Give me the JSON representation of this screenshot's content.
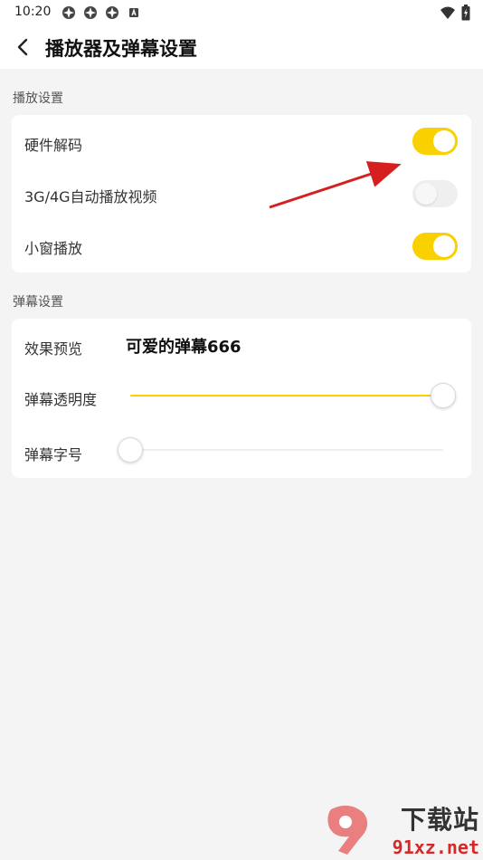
{
  "status_bar": {
    "time": "10:20",
    "left_icons": [
      "app-icon",
      "app-icon",
      "app-icon",
      "a-badge-icon"
    ],
    "right_icons": [
      "wifi-icon",
      "battery-icon"
    ]
  },
  "header": {
    "back_icon": "chevron-left-icon",
    "title": "播放器及弹幕设置"
  },
  "playback_section": {
    "label": "播放设置",
    "rows": [
      {
        "label": "硬件解码",
        "toggle": true
      },
      {
        "label": "3G/4G自动播放视频",
        "toggle": false
      },
      {
        "label": "小窗播放",
        "toggle": true
      }
    ]
  },
  "danmaku_section": {
    "label": "弹幕设置",
    "preview_label": "效果预览",
    "preview_text": "可爱的弹幕666",
    "opacity_label": "弹幕透明度",
    "opacity_value": 1.0,
    "font_size_label": "弹幕字号",
    "font_size_value": 0.0
  },
  "colors": {
    "accent": "#f9d100",
    "annotation_arrow": "#d62020",
    "watermark_red": "#d62828"
  },
  "watermark": {
    "top": "下载站",
    "bottom": "91xz.net"
  }
}
